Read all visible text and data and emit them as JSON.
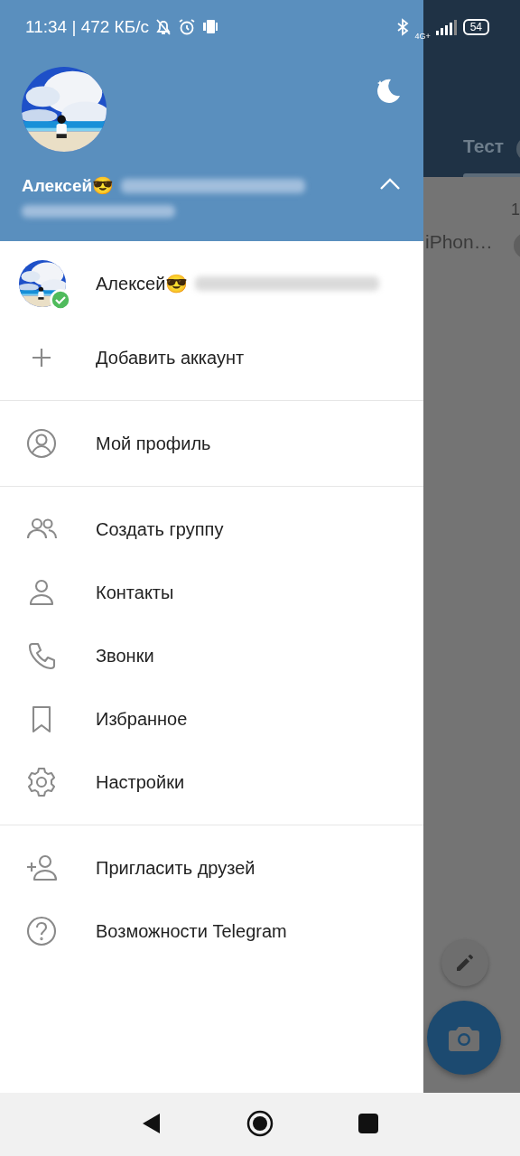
{
  "status_bar": {
    "time": "11:34 | 472 КБ/с",
    "network": "4G+",
    "battery": "54"
  },
  "header": {
    "name": "Алексей😎",
    "expanded": true
  },
  "accounts": [
    {
      "name": "Алексей😎",
      "selected": true
    }
  ],
  "add_account": "Добавить аккаунт",
  "menu_sections": [
    [
      {
        "label": "Мой профиль",
        "kind": "profile"
      }
    ],
    [
      {
        "label": "Создать группу",
        "kind": "group"
      },
      {
        "label": "Контакты",
        "kind": "contact"
      },
      {
        "label": "Звонки",
        "kind": "phone"
      },
      {
        "label": "Избранное",
        "kind": "bookmark"
      },
      {
        "label": "Настройки",
        "kind": "settings"
      }
    ],
    [
      {
        "label": "Пригласить друзей",
        "kind": "invite"
      },
      {
        "label": "Возможности Telegram",
        "kind": "help"
      }
    ]
  ],
  "background": {
    "tab": "Тест",
    "chat_time": "1",
    "chat_preview": "iPhon…"
  }
}
